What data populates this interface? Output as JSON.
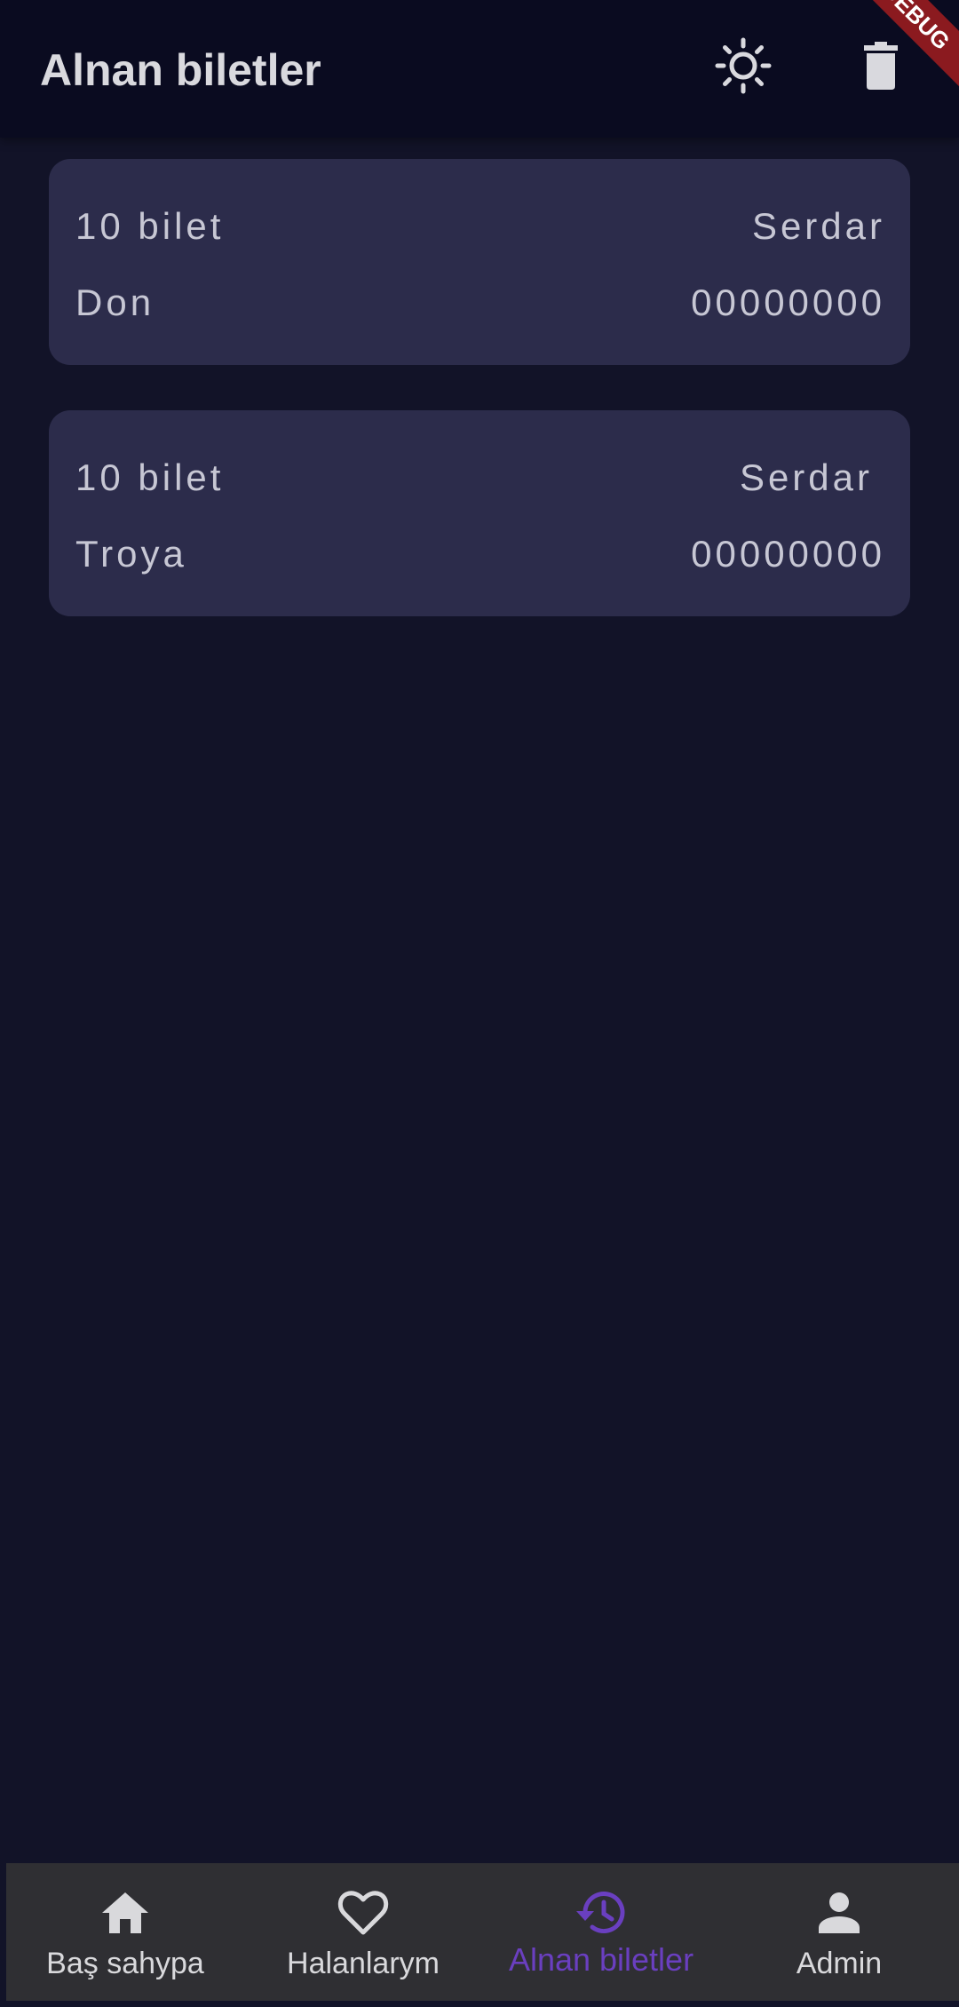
{
  "app_bar": {
    "title": "Alnan biletler",
    "actions": [
      "sun-icon",
      "trash-icon"
    ],
    "debug_banner": "DEBUG"
  },
  "tickets": [
    {
      "count": "10 bilet",
      "name": "Serdar",
      "movie": "Don",
      "phone": "00000000"
    },
    {
      "count": "10 bilet",
      "name": "Serdar",
      "movie": "Troya",
      "phone": "00000000"
    }
  ],
  "bottom_nav": {
    "items": [
      {
        "label": "Baş sahypa",
        "icon": "home-icon"
      },
      {
        "label": "Halanlarym",
        "icon": "heart-icon"
      },
      {
        "label": "Alnan biletler",
        "icon": "history-icon",
        "active": true
      },
      {
        "label": "Admin",
        "icon": "person-icon"
      }
    ],
    "active_color": "#6a3fc0"
  },
  "colors": {
    "background": "#121328",
    "app_bar": "#0a0b20",
    "card": "#2c2c4b",
    "nav_bar": "#2f2f33",
    "accent": "#6a3fc0",
    "debug_ribbon": "#8b1a1f"
  }
}
